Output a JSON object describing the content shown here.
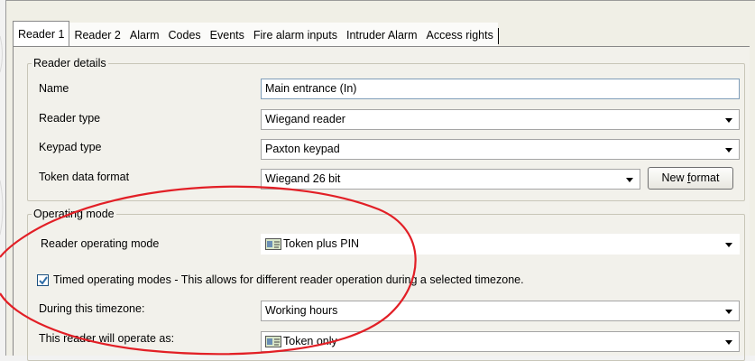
{
  "tabs": [
    "Reader 1",
    "Reader 2",
    "Alarm",
    "Codes",
    "Events",
    "Fire alarm inputs",
    "Intruder Alarm",
    "Access rights"
  ],
  "reader_details": {
    "legend": "Reader details",
    "name_label": "Name",
    "name_value": "Main entrance (In)",
    "reader_type_label": "Reader type",
    "reader_type_value": "Wiegand reader",
    "keypad_type_label": "Keypad type",
    "keypad_type_value": "Paxton keypad",
    "token_format_label": "Token data format",
    "token_format_value": "Wiegand 26 bit",
    "new_format_prefix": "New ",
    "new_format_underlined": "f",
    "new_format_suffix": "ormat"
  },
  "operating_mode": {
    "legend": "Operating mode",
    "reader_mode_label": "Reader operating mode",
    "reader_mode_value": "Token plus PIN",
    "timed_checked": true,
    "timed_label": "Timed operating modes - This allows for different reader operation during a selected timezone.",
    "timezone_label": "During this timezone:",
    "timezone_value": "Working hours",
    "operate_as_label": "This reader will operate as:",
    "operate_as_value": "Token only"
  },
  "colors": {
    "annotation_circle": "#e21f26",
    "checkbox_tick": "#2f6ea8"
  },
  "icons": [
    "token-card-icon",
    "dropdown-arrow-icon",
    "checkmark-icon"
  ]
}
